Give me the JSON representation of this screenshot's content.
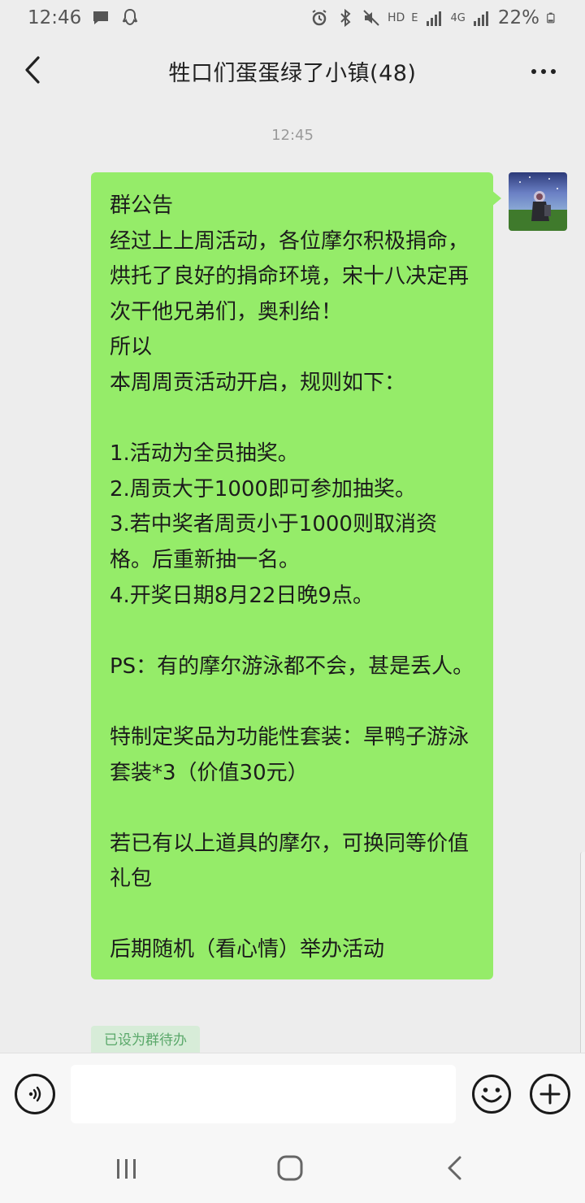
{
  "status_bar": {
    "time": "12:46",
    "network_hd": "HD",
    "network_e": "E",
    "network_4g": "4G",
    "battery": "22%",
    "icons": [
      "chat-icon",
      "qq-icon",
      "alarm-icon",
      "bluetooth-icon",
      "mute-icon",
      "signal-icon",
      "battery-icon"
    ]
  },
  "header": {
    "title": "牲口们蛋蛋绿了小镇(48)"
  },
  "chat": {
    "timestamp": "12:45",
    "message": {
      "text": "群公告\n经过上上周活动，各位摩尔积极捐命，烘托了良好的捐命环境，宋十八决定再次干他兄弟们，奥利给！\n所以\n本周周贡活动开启，规则如下：\n\n1.活动为全员抽奖。\n2.周贡大于1000即可参加抽奖。\n3.若中奖者周贡小于1000则取消资格。后重新抽一名。\n4.开奖日期8月22日晚9点。\n\nPS：有的摩尔游泳都不会，甚是丢人。\n\n特制定奖品为功能性套装：旱鸭子游泳套装*3（价值30元）\n\n若已有以上道具的摩尔，可换同等价值礼包\n\n后期随机（看心情）举办活动",
      "bubble_color": "#95ec69"
    },
    "todo_tag": "已设为群待办"
  },
  "input_bar": {
    "placeholder": "",
    "voice_icon": "voice-icon",
    "emoji_icon": "emoji-icon",
    "plus_icon": "plus-icon"
  },
  "nav_bar": {
    "icons": [
      "recents-icon",
      "home-icon",
      "back-icon"
    ]
  }
}
